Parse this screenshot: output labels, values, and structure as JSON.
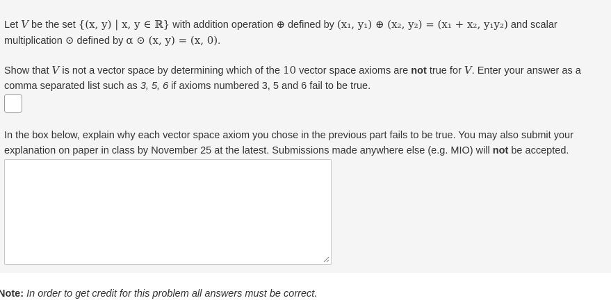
{
  "paragraph1": {
    "t1": "Let ",
    "m_V": "V",
    "t2": " be the set ",
    "m_set": "{(x, y) | x, y ∈ ℝ}",
    "t3": " with addition operation ",
    "m_oplus": "⊕",
    "t4": " defined by ",
    "m_add": "(x₁, y₁) ⊕ (x₂, y₂) = (x₁ + x₂, y₁y₂)",
    "t5": " and scalar",
    "t6": "multiplication ",
    "m_odot": "⊙",
    "t7": " defined by ",
    "m_mult": "α ⊙ (x, y) = (x, 0)",
    "t8": "."
  },
  "paragraph2": {
    "t1": "Show that ",
    "m_V": "V",
    "t2": " is not a vector space by determining which of the ",
    "m_10": "10",
    "t3": " vector space axioms are ",
    "bold_not": "not",
    "t4": " true for ",
    "m_V2": "V",
    "t5": ". Enter your answer as a",
    "t6": "comma separated list such as ",
    "example": "3, 5, 6",
    "t7": " if axioms numbered 3, 5 and 6 fail to be true."
  },
  "answer_input": {
    "value": ""
  },
  "paragraph3": {
    "line1": "In the box below, explain why each vector space axiom you chose in the previous part fails to be true. You may also submit your",
    "line2a": "explanation on paper in class by November 25 at the latest. Submissions made anywhere else (e.g. MIO) will ",
    "bold_not": "not",
    "line2b": " be accepted."
  },
  "explanation_textarea": {
    "value": ""
  },
  "note": {
    "label": "Note:",
    "text": " In order to get credit for this problem all answers must be correct."
  }
}
